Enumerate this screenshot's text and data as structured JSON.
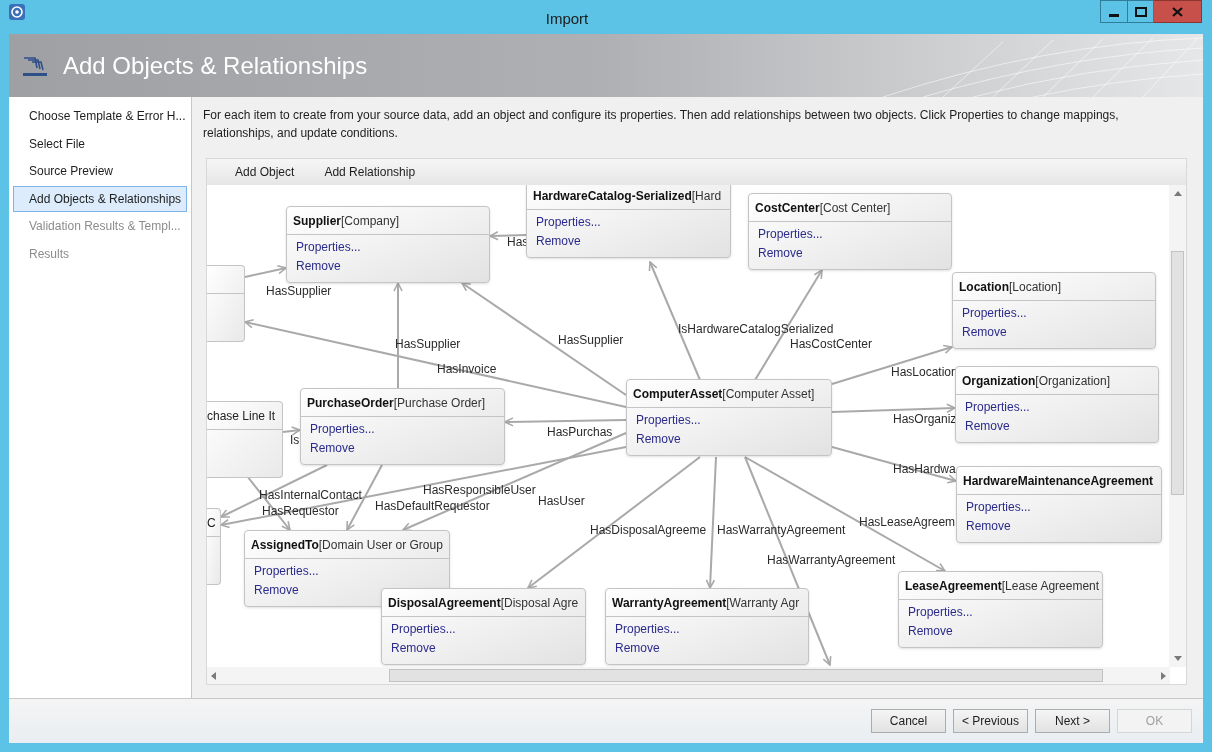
{
  "window": {
    "title": "Import"
  },
  "header": {
    "title": "Add Objects & Relationships"
  },
  "steps": [
    {
      "label": "Choose Template & Error H...",
      "selected": false,
      "disabled": false
    },
    {
      "label": "Select File",
      "selected": false,
      "disabled": false
    },
    {
      "label": "Source Preview",
      "selected": false,
      "disabled": false
    },
    {
      "label": "Add Objects & Relationships",
      "selected": true,
      "disabled": false
    },
    {
      "label": "Validation Results & Templ...",
      "selected": false,
      "disabled": true
    },
    {
      "label": "Results",
      "selected": false,
      "disabled": true
    }
  ],
  "instructions": "For each item to create from your source data, add an object and configure its properties. Then add relationships between two objects. Click Properties to change mappings, relationships, and update conditions.",
  "toolbar": [
    "Add Object",
    "Add Relationship"
  ],
  "nodes": [
    {
      "kind": "clipped"
    },
    {
      "kind": "object",
      "name": "Supplier",
      "type": "[Company]",
      "actions": [
        "Properties...",
        "Remove"
      ]
    },
    {
      "kind": "object",
      "name": "HardwareCatalog-Serialized",
      "type": "[Hard",
      "actions": [
        "Properties...",
        "Remove"
      ]
    },
    {
      "kind": "object",
      "name": "CostCenter",
      "type": "[Cost Center]",
      "actions": [
        "Properties...",
        "Remove"
      ]
    },
    {
      "kind": "object",
      "name": "Location",
      "type": "[Location]",
      "actions": [
        "Properties...",
        "Remove"
      ]
    },
    {
      "kind": "clipped",
      "name": "chase Line It"
    },
    {
      "kind": "object",
      "name": "PurchaseOrder",
      "type": "[Purchase Order]",
      "actions": [
        "Properties...",
        "Remove"
      ]
    },
    {
      "kind": "object",
      "name": "ComputerAsset",
      "type": "[Computer Asset]",
      "actions": [
        "Properties...",
        "Remove"
      ]
    },
    {
      "kind": "object",
      "name": "Organization",
      "type": "[Organization]",
      "actions": [
        "Properties...",
        "Remove"
      ]
    },
    {
      "kind": "clipped",
      "name": "C"
    },
    {
      "kind": "object",
      "name": "AssignedTo",
      "type": "[Domain User or Group",
      "actions": [
        "Properties...",
        "Remove"
      ]
    },
    {
      "kind": "object",
      "name": "DisposalAgreement",
      "type": "[Disposal Agre",
      "actions": [
        "Properties...",
        "Remove"
      ]
    },
    {
      "kind": "object",
      "name": "WarrantyAgreement",
      "type": "[Warranty Agr",
      "actions": [
        "Properties...",
        "Remove"
      ]
    },
    {
      "kind": "object",
      "name": "LeaseAgreement",
      "type": "[Lease Agreement",
      "actions": [
        "Properties...",
        "Remove"
      ]
    },
    {
      "kind": "object",
      "name": "HardwareMaintenanceAgreement",
      "actions": [
        "Properties...",
        "Remove"
      ]
    }
  ],
  "relationship_labels": [
    "Has",
    "HasSupplier",
    "HasSupplier",
    "HasSupplier",
    "IsHardwareCatalogSerialized",
    "HasCostCenter",
    "HasInvoice",
    "HasLocation",
    "Is",
    "HasPurchas",
    "HasOrganiz",
    "HasHardwa",
    "HasInternalContact",
    "HasRequestor",
    "HasDefaultRequestor",
    "HasResponsibleUser",
    "HasUser",
    "HasDisposalAgreeme",
    "HasWarrantyAgreement",
    "HasLeaseAgreem",
    "HasWarrantyAgreement"
  ],
  "buttons": [
    {
      "label": "Cancel",
      "disabled": false
    },
    {
      "label": "< Previous",
      "disabled": false
    },
    {
      "label": "Next >",
      "disabled": false
    },
    {
      "label": "OK",
      "disabled": true
    }
  ]
}
